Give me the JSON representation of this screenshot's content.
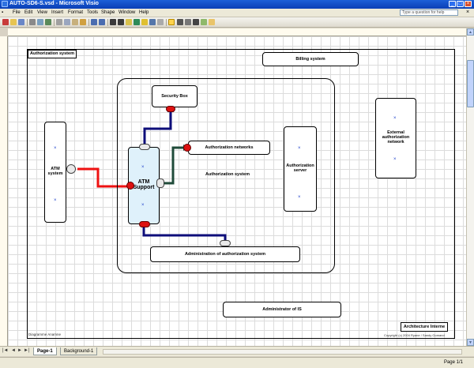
{
  "window": {
    "title": "AUTO-SD6-S.vsd - Microsoft Visio",
    "help_placeholder": "Type a question for help"
  },
  "menu": [
    "File",
    "Edit",
    "View",
    "Insert",
    "Format",
    "Tools",
    "Shape",
    "Window",
    "Help"
  ],
  "colors": {
    "titlebar": "#0a3fb5",
    "atm_fill": "#dff1fb",
    "red_connector": "#ee1111",
    "blue_connector": "#0e0e7a",
    "green_connector": "#1f4b3a"
  },
  "icons": [
    "visio-app-icon",
    "minimize-icon",
    "maximize-icon",
    "close-icon",
    "new-icon",
    "open-icon",
    "save-icon",
    "print-icon",
    "undo-icon",
    "redo-icon",
    "pointer-icon",
    "connector-icon",
    "text-icon",
    "line-color-icon",
    "scroll-up-icon",
    "scroll-down-icon"
  ],
  "diagram": {
    "corner_label": "Authorization system",
    "billing": "Billing system",
    "security_box": "Security Box",
    "auth_networks": "Authorization networks",
    "atm_system": "ATM system",
    "atm_support": "ATM Support",
    "auth_system_center": "Authorization system",
    "auth_server": "Authorization server",
    "external_network": "External authorization network",
    "admin_auth": "Administration of authorization system",
    "admin_is": "Administrator of IS",
    "architecture_title": "Architecture Interne",
    "footer_left": "Diagramme Anamne",
    "footer_right": "Copyright (c) 2004 Ryane / Sandy Gomand"
  },
  "tabs": [
    "Page-1",
    "Background-1"
  ],
  "status": {
    "page": "Page 1/1"
  }
}
